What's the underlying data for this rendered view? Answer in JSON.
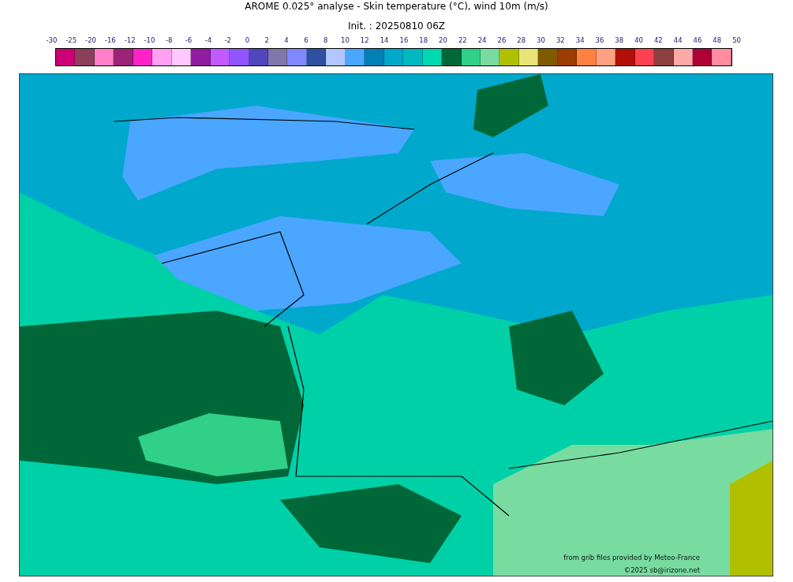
{
  "title": "AROME 0.025° analyse - Skin temperature (°C), wind 10m (m/s)",
  "subtitle": "Init. : 20250810 06Z",
  "scale_labels": [
    "-30",
    "-25",
    "-20",
    "-16",
    "-12",
    "-10",
    "-8",
    "-6",
    "-4",
    "-2",
    "0",
    "2",
    "4",
    "6",
    "8",
    "10",
    "12",
    "14",
    "16",
    "18",
    "20",
    "22",
    "24",
    "26",
    "28",
    "30",
    "32",
    "34",
    "36",
    "38",
    "40",
    "42",
    "44",
    "46",
    "48",
    "50"
  ],
  "colorbar": [
    {
      "color": "#cc0077"
    },
    {
      "color": "#8b3f5b"
    },
    {
      "color": "#ff80c8"
    },
    {
      "color": "#9b2378"
    },
    {
      "color": "#ff22c8"
    },
    {
      "color": "#ffa0f0"
    },
    {
      "color": "#ffc8ff"
    },
    {
      "color": "#901ca0"
    },
    {
      "color": "#c05aff"
    },
    {
      "color": "#9055ff"
    },
    {
      "color": "#5046be"
    },
    {
      "color": "#8078a8"
    },
    {
      "color": "#8088ff"
    },
    {
      "color": "#2e50a0"
    },
    {
      "color": "#b0c8ff"
    },
    {
      "color": "#4aa6ff"
    },
    {
      "color": "#0080b4"
    },
    {
      "color": "#00a8cc"
    },
    {
      "color": "#00b8c0"
    },
    {
      "color": "#00d8b0"
    },
    {
      "color": "#006838"
    },
    {
      "color": "#30d088"
    },
    {
      "color": "#78dca0"
    },
    {
      "color": "#b0c000"
    },
    {
      "color": "#e8e478"
    },
    {
      "color": "#805a00"
    },
    {
      "color": "#9c3c00"
    },
    {
      "color": "#ff8040"
    },
    {
      "color": "#ffa080"
    },
    {
      "color": "#b01008"
    },
    {
      "color": "#ff4050"
    },
    {
      "color": "#8c4040"
    },
    {
      "color": "#ffa8a8"
    },
    {
      "color": "#b00038"
    },
    {
      "color": "#ff8ca0"
    }
  ],
  "credits": [
    "from grib files provided by Meteo-France",
    "©2025 sb@irizone.net"
  ]
}
